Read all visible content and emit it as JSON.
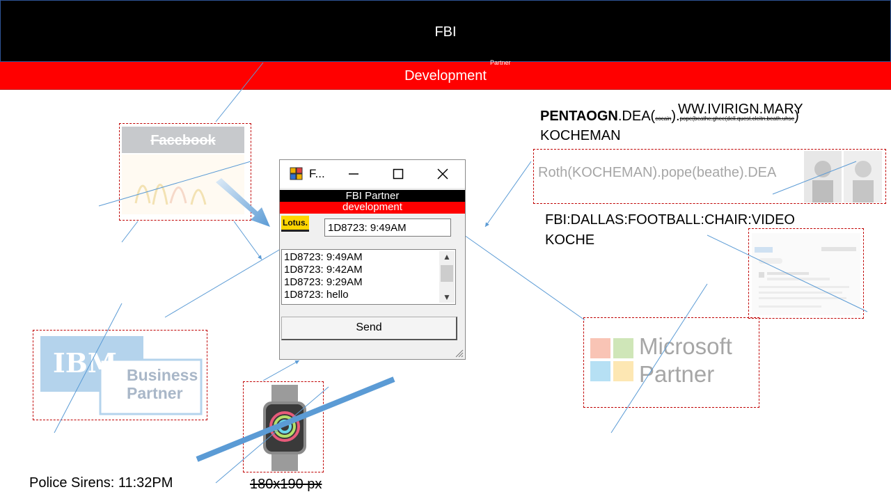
{
  "header": {
    "title": "FBI"
  },
  "subheader": {
    "title": "Development",
    "superscript": "Partner"
  },
  "facebook_card": {
    "label": "Facebook"
  },
  "ibm_card": {
    "logo": "IBM",
    "line1": "Business",
    "line2": "Partner"
  },
  "window": {
    "title": "F...",
    "banner_line1": "FBI Partner",
    "banner_line2": "development",
    "lotus_label": "Lotus.",
    "input_value": "1D8723: 9:49AM",
    "messages": [
      "1D8723: 9:49AM",
      "1D8723: 9:42AM",
      "1D8723: 9:29AM",
      "1D8723: hello"
    ],
    "send_label": "Send"
  },
  "right_heading": {
    "bold": "PENTAOGN",
    "part2": ".DEA(",
    "small_strike": "cocain",
    "part3": ").",
    "overlay": "WW.IVIRIGN.MARY",
    "small_strike2": "pope(beathe:ghee(dell.quest.cleitn.beath.uhse",
    "part4": ")",
    "line2": "KOCHEMAN"
  },
  "roth_box": {
    "text": "Roth(KOCHEMAN).pope(beathe).DEA"
  },
  "fbi_dallas": {
    "line1": "FBI:DALLAS:FOOTBALL:CHAIR:VIDEO",
    "line2": "KOCHE"
  },
  "microsoft_card": {
    "line1": "Microsoft",
    "line2": "Partner"
  },
  "footer": {
    "sirens": "Police Sirens: 11:32PM",
    "size_label": "180x190 px"
  },
  "colors": {
    "red": "#ff0000",
    "black": "#000000",
    "line_blue": "#5b9bd5",
    "dashed_border": "#c00000"
  }
}
